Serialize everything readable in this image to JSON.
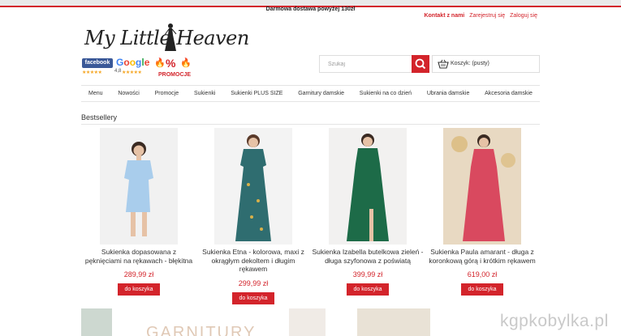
{
  "topbar": {
    "text": "Darmowa dostawa powyżej 130zł"
  },
  "toplinks": {
    "contact": "Kontakt z nami",
    "register": "Zarejestruj się",
    "login": "Zaloguj się"
  },
  "logo": {
    "text": "My Little Heaven"
  },
  "badges": {
    "facebook": "facebook",
    "google": [
      "G",
      "o",
      "o",
      "g",
      "l",
      "e"
    ],
    "google_rating": "4,8",
    "stars": "★★★★★",
    "promo_symbol": "%",
    "promo_label": "PROMOCJE"
  },
  "search": {
    "placeholder": "Szukaj"
  },
  "cart": {
    "label": "Koszyk: (pusty)"
  },
  "nav": [
    "Menu",
    "Nowości",
    "Promocje",
    "Sukienki",
    "Sukienki PLUS SIZE",
    "Garnitury damskie",
    "Sukienki na co dzień",
    "Ubrania damskie",
    "Akcesoria damskie"
  ],
  "section": {
    "title": "Bestsellery"
  },
  "products": [
    {
      "name": "Sukienka dopasowana z pęknięciami na rękawach - błękitna",
      "price": "289,99 zł",
      "button": "do koszyka",
      "dress_color": "#a9cdec",
      "bg_color": "#f1f1f1"
    },
    {
      "name": "Sukienka Etna - kolorowa, maxi z okrągłym dekoltem i długim rękawem",
      "price": "299,99 zł",
      "button": "do koszyka",
      "dress_color": "#2f6d70",
      "bg_color": "#f3f3f3"
    },
    {
      "name": "Sukienka Izabella butelkowa zieleń - długa szyfonowa z poświatą",
      "price": "399,99 zł",
      "button": "do koszyka",
      "dress_color": "#1d6b48",
      "bg_color": "#f2f1f0"
    },
    {
      "name": "Sukienka Paula amarant - długa z koronkową górą i krótkim rękawem",
      "price": "619,00 zł",
      "button": "do koszyka",
      "dress_color": "#d9495f",
      "bg_color": "#e8d9c2"
    }
  ],
  "banner": {
    "text": "GARNITURY"
  },
  "watermark": {
    "text": "kgpkobylka.pl"
  },
  "colors": {
    "accent": "#d3242b"
  }
}
